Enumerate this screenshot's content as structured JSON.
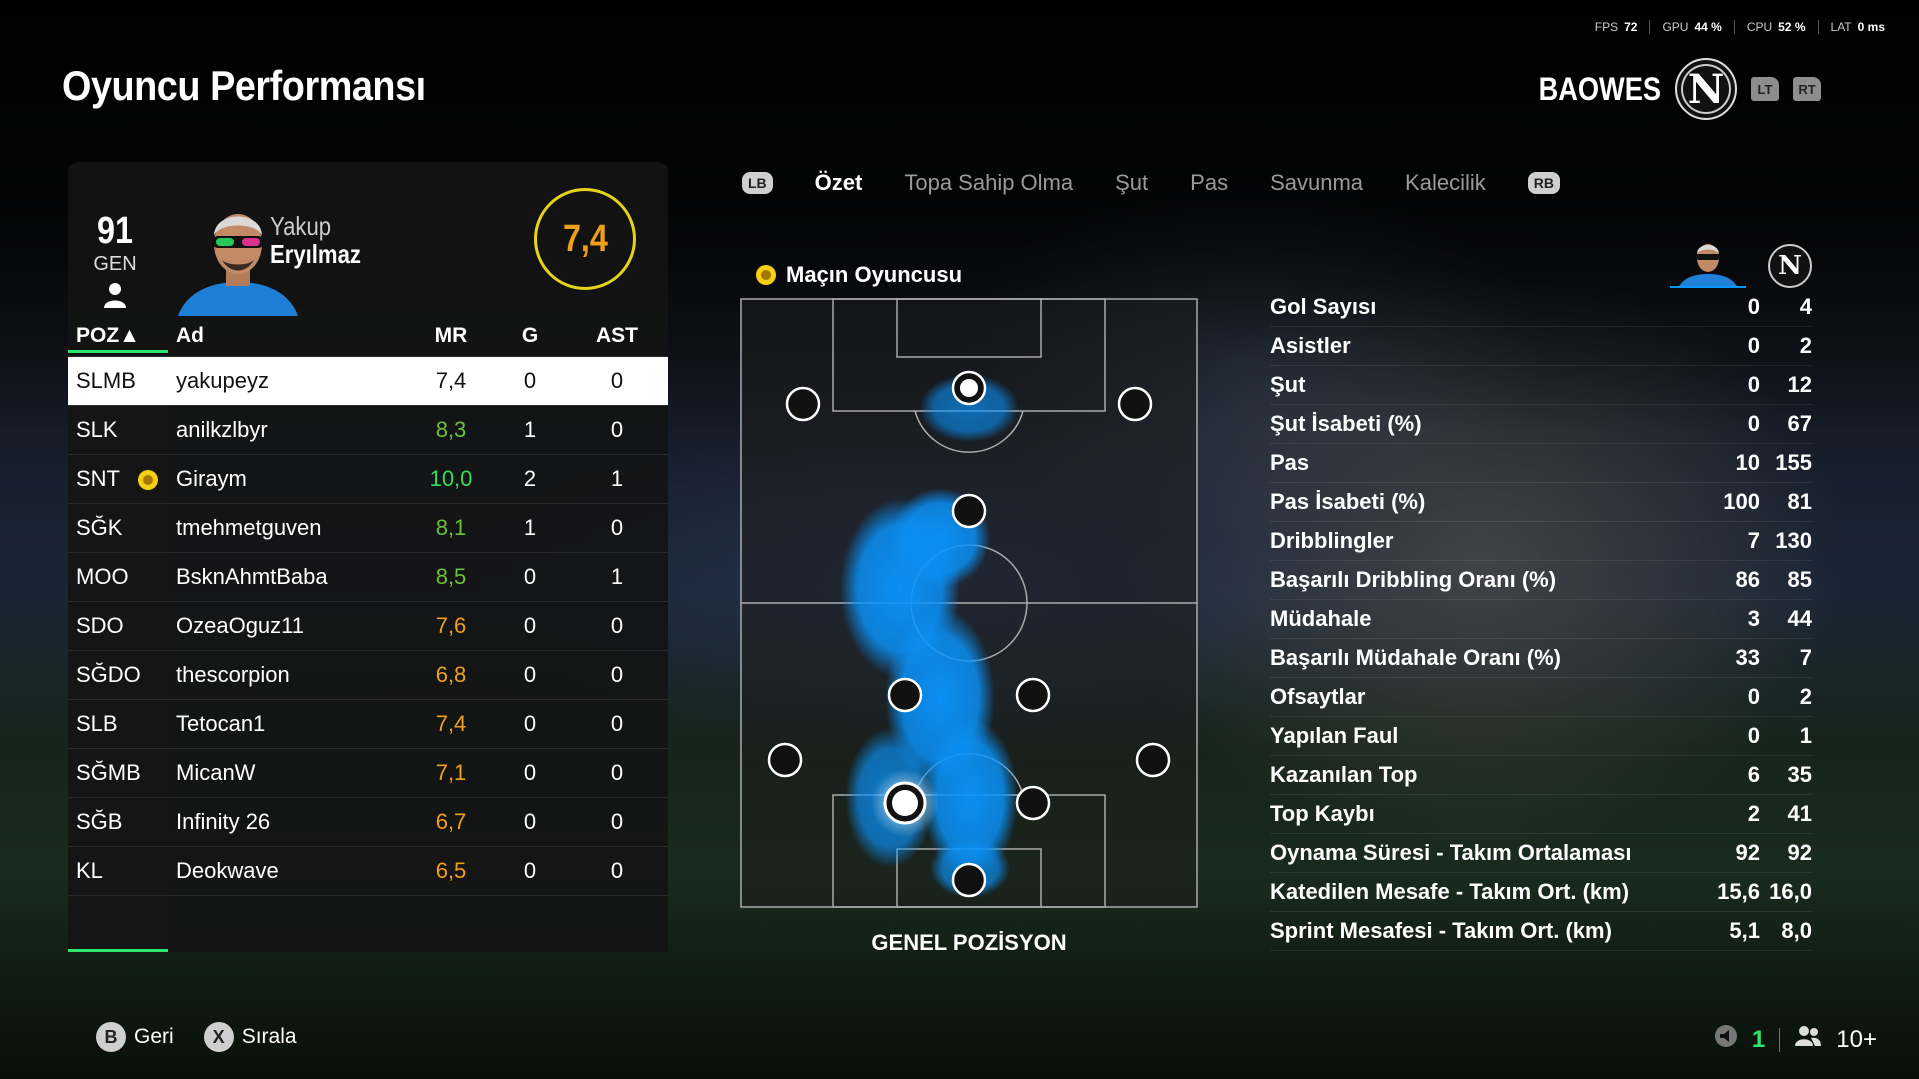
{
  "perf": {
    "fps_label": "FPS",
    "fps": "72",
    "gpu_label": "GPU",
    "gpu": "44 %",
    "cpu_label": "CPU",
    "cpu": "52 %",
    "lat_label": "LAT",
    "lat": "0 ms"
  },
  "title": "Oyuncu Performansı",
  "club": {
    "name": "BAOWES",
    "crest": "N",
    "lt": "LT",
    "rt": "RT"
  },
  "player": {
    "gen": "91",
    "gen_label": "GEN",
    "first": "Yakup",
    "last": "Eryılmaz",
    "rating": "7,4"
  },
  "table": {
    "headers": {
      "pos": "POZ▲",
      "name": "Ad",
      "mr": "MR",
      "g": "G",
      "ast": "AST"
    },
    "rows": [
      {
        "pos": "SLMB",
        "name": "yakupeyz",
        "mr": "7,4",
        "g": "0",
        "ast": "0"
      },
      {
        "pos": "SLK",
        "name": "anilkzlbyr",
        "mr": "8,3",
        "g": "1",
        "ast": "0"
      },
      {
        "pos": "SNT",
        "name": "Giraym",
        "mr": "10,0",
        "g": "2",
        "ast": "1"
      },
      {
        "pos": "SĞK",
        "name": "tmehmetguven",
        "mr": "8,1",
        "g": "1",
        "ast": "0"
      },
      {
        "pos": "MOO",
        "name": "BsknAhmtBaba",
        "mr": "8,5",
        "g": "0",
        "ast": "1"
      },
      {
        "pos": "SDO",
        "name": "OzeaOguz11",
        "mr": "7,6",
        "g": "0",
        "ast": "0"
      },
      {
        "pos": "SĞDO",
        "name": "thescorpion",
        "mr": "6,8",
        "g": "0",
        "ast": "0"
      },
      {
        "pos": "SLB",
        "name": "Tetocan1",
        "mr": "7,4",
        "g": "0",
        "ast": "0"
      },
      {
        "pos": "SĞMB",
        "name": "MicanW",
        "mr": "7,1",
        "g": "0",
        "ast": "0"
      },
      {
        "pos": "SĞB",
        "name": "Infinity 26",
        "mr": "6,7",
        "g": "0",
        "ast": "0"
      },
      {
        "pos": "KL",
        "name": "Deokwave",
        "mr": "6,5",
        "g": "0",
        "ast": "0"
      }
    ]
  },
  "tabs": {
    "lb": "LB",
    "rb": "RB",
    "items": [
      "Özet",
      "Topa Sahip Olma",
      "Şut",
      "Pas",
      "Savunma",
      "Kalecilik"
    ]
  },
  "motm_title": "Maçın Oyuncusu",
  "pitch_label": "GENEL POZİSYON",
  "stats": [
    {
      "label": "Gol Sayısı",
      "a": "0",
      "b": "4"
    },
    {
      "label": "Asistler",
      "a": "0",
      "b": "2"
    },
    {
      "label": "Şut",
      "a": "0",
      "b": "12"
    },
    {
      "label": "Şut İsabeti (%)",
      "a": "0",
      "b": "67"
    },
    {
      "label": "Pas",
      "a": "10",
      "b": "155"
    },
    {
      "label": "Pas İsabeti (%)",
      "a": "100",
      "b": "81"
    },
    {
      "label": "Dribblingler",
      "a": "7",
      "b": "130"
    },
    {
      "label": "Başarılı Dribbling Oranı (%)",
      "a": "86",
      "b": "85"
    },
    {
      "label": "Müdahale",
      "a": "3",
      "b": "44"
    },
    {
      "label": "Başarılı Müdahale Oranı (%)",
      "a": "33",
      "b": "7"
    },
    {
      "label": "Ofsaytlar",
      "a": "0",
      "b": "2"
    },
    {
      "label": "Yapılan Faul",
      "a": "0",
      "b": "1"
    },
    {
      "label": "Kazanılan Top",
      "a": "6",
      "b": "35"
    },
    {
      "label": "Top Kaybı",
      "a": "2",
      "b": "41"
    },
    {
      "label": "Oynama Süresi - Takım Ortalaması",
      "a": "92",
      "b": "92"
    },
    {
      "label": "Katedilen Mesafe - Takım Ort. (km)",
      "a": "15,6",
      "b": "16,0"
    },
    {
      "label": "Sprint Mesafesi - Takım Ort. (km)",
      "a": "5,1",
      "b": "8,0"
    }
  ],
  "footer": {
    "b": "B",
    "back": "Geri",
    "x": "X",
    "sort": "Sırala",
    "count": "1",
    "players": "10+"
  },
  "colors": {
    "accent_green": "#2ee66b",
    "rating_orange": "#f0a018",
    "heatmap_blue": "#0a96ff",
    "motm_yellow": "#f4cf14"
  }
}
